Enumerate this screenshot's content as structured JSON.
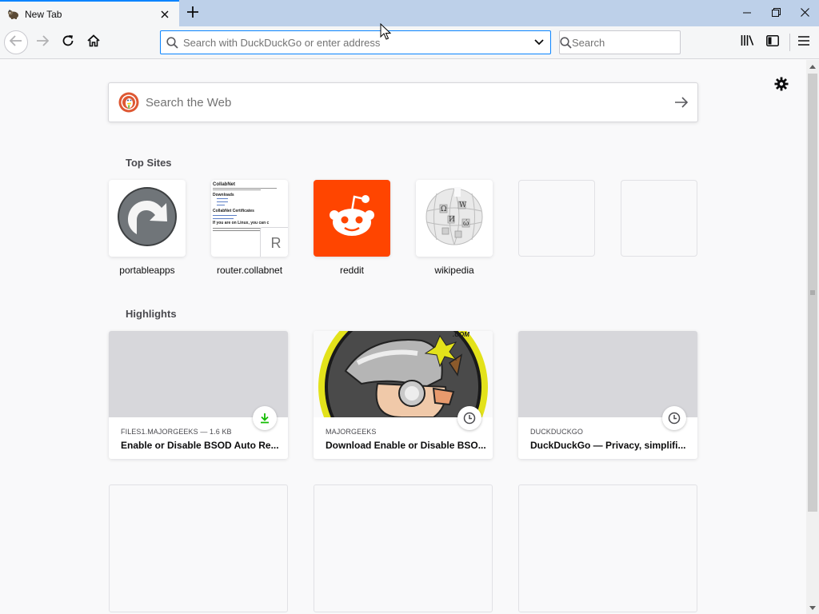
{
  "tab": {
    "title": "New Tab"
  },
  "icons": {
    "favicon": "dog-favicon-icon",
    "tab_close": "close-icon",
    "new_tab": "plus-icon",
    "minimize": "minimize-icon",
    "restore": "restore-icon",
    "close_window": "close-icon",
    "back": "arrow-left-icon",
    "forward": "arrow-right-icon",
    "reload": "reload-icon",
    "home": "home-icon",
    "search": "search-icon",
    "dropdown": "chevron-down-icon",
    "library": "library-icon",
    "sidebar": "sidebar-icon",
    "menu": "hamburger-menu-icon",
    "settings": "gear-icon",
    "duckduckgo": "duckduckgo-logo-icon",
    "go": "arrow-right-icon",
    "download": "download-icon",
    "clock": "clock-icon"
  },
  "urlbar": {
    "placeholder": "Search with DuckDuckGo or enter address"
  },
  "searchbar": {
    "placeholder": "Search"
  },
  "websearch": {
    "placeholder": "Search the Web"
  },
  "top_sites": {
    "title": "Top Sites",
    "items": [
      {
        "label": "portableapps"
      },
      {
        "label": "router.collabnet",
        "fallback_letter": "R",
        "preview": {
          "heading": "CollabNet",
          "line1": "Downloads",
          "line2": "CollabNet Certificates",
          "line3": "If you are on Linux, you can c"
        }
      },
      {
        "label": "reddit"
      },
      {
        "label": "wikipedia"
      },
      {
        "label": ""
      },
      {
        "label": ""
      }
    ]
  },
  "highlights": {
    "title": "Highlights",
    "items": [
      {
        "context": "FILES1.MAJORGEEKS — 1.6 KB",
        "title": "Enable or Disable BSOD Auto Re...",
        "badge": "download-icon"
      },
      {
        "context": "MAJORGEEKS",
        "title": "Download Enable or Disable BSO...",
        "badge": "clock-icon",
        "image_text": ".COM"
      },
      {
        "context": "DUCKDUCKGO",
        "title": "DuckDuckGo — Privacy, simplifi...",
        "badge": "clock-icon"
      }
    ]
  },
  "colors": {
    "accent": "#0a84ff",
    "reddit": "#ff4500",
    "download_green": "#12bc00",
    "tabbar": "#bdd0e9"
  }
}
